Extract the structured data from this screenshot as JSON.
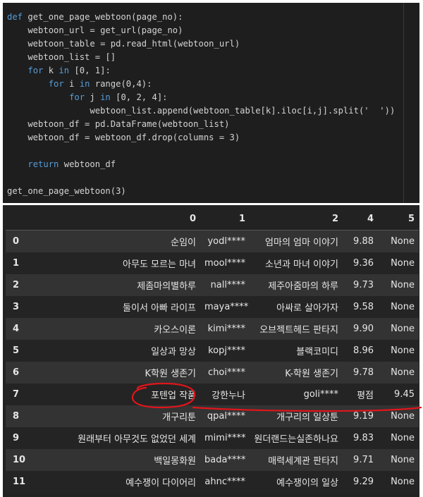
{
  "code": {
    "lines": [
      [
        {
          "t": "def",
          "k": "kw"
        },
        {
          "t": " get_one_page_webtoon(page_no):",
          "k": "tx"
        }
      ],
      [
        {
          "t": "    webtoon_url = get_url(page_no)",
          "k": "tx"
        }
      ],
      [
        {
          "t": "    webtoon_table = pd.read_html(webtoon_url)",
          "k": "tx"
        }
      ],
      [
        {
          "t": "    webtoon_list = []",
          "k": "tx"
        }
      ],
      [
        {
          "t": "    ",
          "k": "tx"
        },
        {
          "t": "for",
          "k": "kw"
        },
        {
          "t": " k ",
          "k": "tx"
        },
        {
          "t": "in",
          "k": "kw"
        },
        {
          "t": " [0, 1]:",
          "k": "tx"
        }
      ],
      [
        {
          "t": "        ",
          "k": "tx"
        },
        {
          "t": "for",
          "k": "kw"
        },
        {
          "t": " i ",
          "k": "tx"
        },
        {
          "t": "in",
          "k": "kw"
        },
        {
          "t": " range(0,4):",
          "k": "tx"
        }
      ],
      [
        {
          "t": "            ",
          "k": "tx"
        },
        {
          "t": "for",
          "k": "kw"
        },
        {
          "t": " j ",
          "k": "tx"
        },
        {
          "t": "in",
          "k": "kw"
        },
        {
          "t": " [0, 2, 4]:",
          "k": "tx"
        }
      ],
      [
        {
          "t": "                webtoon_list.append(webtoon_table[k].iloc[i,j].split('  '))",
          "k": "tx"
        }
      ],
      [
        {
          "t": "    webtoon_df = pd.DataFrame(webtoon_list)",
          "k": "tx"
        }
      ],
      [
        {
          "t": "    webtoon_df = webtoon_df.drop(columns = 3)",
          "k": "tx"
        }
      ],
      [
        {
          "t": "",
          "k": "tx"
        }
      ],
      [
        {
          "t": "    ",
          "k": "tx"
        },
        {
          "t": "return",
          "k": "kw"
        },
        {
          "t": " webtoon_df",
          "k": "tx"
        }
      ],
      [
        {
          "t": "",
          "k": "tx"
        }
      ],
      [
        {
          "t": "get_one_page_webtoon(3)",
          "k": "tx"
        }
      ]
    ]
  },
  "colors": {
    "keyword": "#569cd6",
    "text": "#d4d4d4",
    "annotation": "#e0151b"
  },
  "dataframe": {
    "columns": [
      "",
      "0",
      "1",
      "2",
      "4",
      "5"
    ],
    "rows": [
      [
        "0",
        "순임이",
        "yodl****",
        "엄마의 엄마 이야기",
        "9.88",
        "None"
      ],
      [
        "1",
        "아무도 모르는 마녀",
        "mool****",
        "소년과 마녀 이야기",
        "9.36",
        "None"
      ],
      [
        "2",
        "제좀마의별하루",
        "nall****",
        "제주아줌마의 하루",
        "9.73",
        "None"
      ],
      [
        "3",
        "둘이서 아빠 라이프",
        "maya****",
        "아싸로 살아가자",
        "9.58",
        "None"
      ],
      [
        "4",
        "카오스이론",
        "kimi****",
        "오브젝트헤드 판타지",
        "9.90",
        "None"
      ],
      [
        "5",
        "일상과 망상",
        "kopj****",
        "블랙코미디",
        "8.96",
        "None"
      ],
      [
        "6",
        "K학원 생존기",
        "choi****",
        "K-학원 생존기",
        "9.78",
        "None"
      ],
      [
        "7",
        "포텐업 작품",
        "강한누나",
        "goli****",
        "평점",
        "9.45"
      ],
      [
        "8",
        "개구리툰",
        "qpal****",
        "개구리의 일상툰",
        "9.19",
        "None"
      ],
      [
        "9",
        "원래부터 아무것도 없었던 세계",
        "mimi****",
        "원더랜드는실존하나요",
        "9.83",
        "None"
      ],
      [
        "10",
        "백일몽화원",
        "bada****",
        "매력세계관 판타지",
        "9.71",
        "None"
      ],
      [
        "11",
        "예수쟁이 다이어리",
        "ahnc****",
        "예수쟁이의 일상",
        "9.29",
        "None"
      ]
    ]
  }
}
